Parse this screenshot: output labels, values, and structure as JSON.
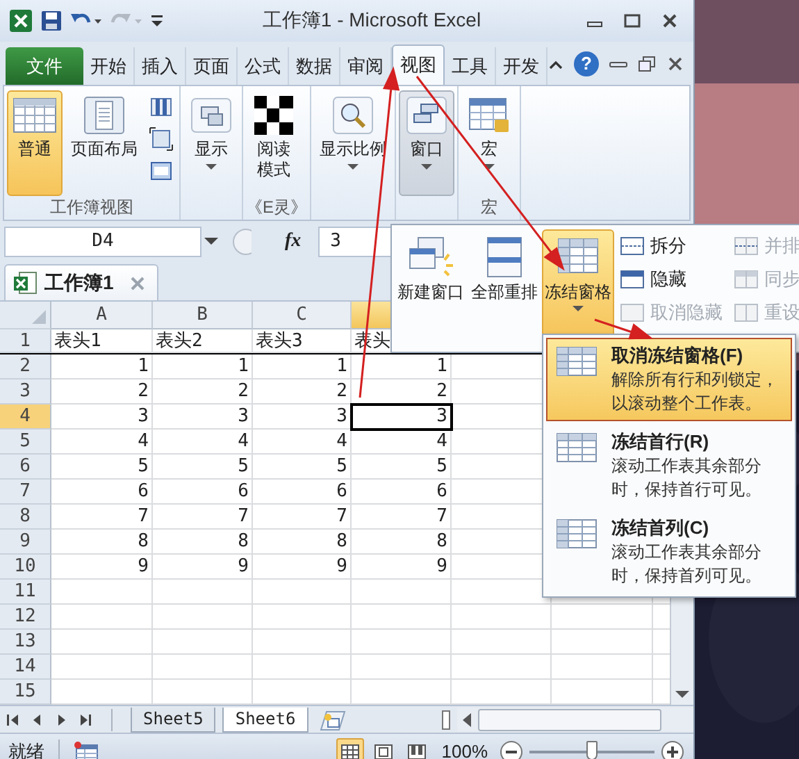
{
  "title_bar": {
    "title": "工作簿1 - Microsoft Excel",
    "quick_access": [
      {
        "kind": "save",
        "disabled": false
      },
      {
        "kind": "undo",
        "disabled": false
      },
      {
        "kind": "redo",
        "disabled": true
      }
    ]
  },
  "ribbon_tabs": [
    {
      "label": "文件",
      "kind": "file",
      "selected": false
    },
    {
      "label": "开始",
      "kind": "tab",
      "selected": false
    },
    {
      "label": "插入",
      "kind": "tab",
      "selected": false
    },
    {
      "label": "页面",
      "kind": "tab",
      "selected": false
    },
    {
      "label": "公式",
      "kind": "tab",
      "selected": false
    },
    {
      "label": "数据",
      "kind": "tab",
      "selected": false
    },
    {
      "label": "审阅",
      "kind": "tab",
      "selected": false
    },
    {
      "label": "视图",
      "kind": "tab",
      "selected": true
    },
    {
      "label": "工具",
      "kind": "tab",
      "selected": false
    },
    {
      "label": "开发",
      "kind": "tab",
      "selected": false
    }
  ],
  "help": "?",
  "ribbon_groups": [
    {
      "label": "工作簿视图",
      "buttons": [
        {
          "kind": "large",
          "label": "普通",
          "selected": true,
          "dropdown": false,
          "expanded": false
        },
        {
          "kind": "large",
          "label": "页面布局",
          "selected": false,
          "dropdown": false,
          "expanded": false
        },
        {
          "kind": "stack"
        }
      ]
    },
    {
      "buttons": [
        {
          "kind": "large",
          "label": "显示",
          "selected": false,
          "dropdown": true,
          "expanded": false
        }
      ]
    },
    {
      "label": "《E灵》",
      "buttons": [
        {
          "kind": "large",
          "label": "阅读模式",
          "selected": false,
          "dropdown": false,
          "expanded": false
        }
      ]
    },
    {
      "buttons": [
        {
          "kind": "large",
          "label": "显示比例",
          "selected": false,
          "dropdown": true,
          "expanded": false
        }
      ]
    },
    {
      "buttons": [
        {
          "kind": "large",
          "label": "窗口",
          "selected": false,
          "dropdown": true,
          "expanded": true
        }
      ]
    },
    {
      "label": "宏",
      "buttons": [
        {
          "kind": "large",
          "label": "宏",
          "selected": false,
          "dropdown": true,
          "expanded": false
        }
      ]
    }
  ],
  "formula_bar": {
    "name_box": "D4",
    "fx": "fx",
    "value": "3"
  },
  "workbook_tab": {
    "title": "工作簿1"
  },
  "sheet": {
    "columns": [
      {
        "label": "A",
        "selected": false
      },
      {
        "label": "B",
        "selected": false
      },
      {
        "label": "C",
        "selected": false
      },
      {
        "selected": true
      }
    ],
    "rows": [
      {
        "header": "1",
        "kind": "header",
        "selected": false,
        "cells": [
          "表头1",
          "表头2",
          "表头3",
          "表头"
        ]
      },
      {
        "header": "2",
        "kind": "data",
        "selected": false,
        "cells": [
          "1",
          "1",
          "1",
          "1"
        ]
      },
      {
        "header": "3",
        "kind": "data",
        "selected": false,
        "cells": [
          "2",
          "2",
          "2",
          "2"
        ]
      },
      {
        "header": "4",
        "kind": "data",
        "selected": true,
        "cells": [
          "3",
          "3",
          "3",
          "3"
        ]
      },
      {
        "header": "5",
        "kind": "data",
        "selected": false,
        "cells": [
          "4",
          "4",
          "4",
          "4"
        ]
      },
      {
        "header": "6",
        "kind": "data",
        "selected": false,
        "cells": [
          "5",
          "5",
          "5",
          "5"
        ]
      },
      {
        "header": "7",
        "kind": "data",
        "selected": false,
        "cells": [
          "6",
          "6",
          "6",
          "6"
        ]
      },
      {
        "header": "8",
        "kind": "data",
        "selected": false,
        "cells": [
          "7",
          "7",
          "7",
          "7"
        ]
      },
      {
        "header": "9",
        "kind": "data",
        "selected": false,
        "cells": [
          "8",
          "8",
          "8",
          "8"
        ]
      },
      {
        "header": "10",
        "kind": "data",
        "selected": false,
        "cells": [
          "9",
          "9",
          "9",
          "9"
        ]
      },
      {
        "header": "11",
        "kind": "data",
        "selected": false,
        "cells": []
      },
      {
        "header": "12",
        "kind": "data",
        "selected": false,
        "cells": []
      },
      {
        "header": "13",
        "kind": "data",
        "selected": false,
        "cells": []
      },
      {
        "header": "14",
        "kind": "data",
        "selected": false,
        "cells": []
      },
      {
        "header": "15",
        "kind": "data",
        "selected": false,
        "cells": []
      }
    ]
  },
  "sheet_tabs": [
    {
      "label": "Sheet5",
      "selected": false
    },
    {
      "label": "Sheet6",
      "selected": true
    }
  ],
  "status_bar": {
    "status": "就绪",
    "views": [
      {
        "kind": "normal",
        "selected": true
      },
      {
        "kind": "layout",
        "selected": false
      },
      {
        "kind": "break",
        "selected": false
      }
    ],
    "zoom": "100%",
    "zoom_slider": {
      "level": 0.5
    }
  },
  "window_panel": {
    "large": [
      {
        "label": "新建窗口",
        "selected": false,
        "dropdown": false
      },
      {
        "label": "全部重排",
        "selected": false,
        "dropdown": false
      },
      {
        "label": "冻结窗格",
        "selected": true,
        "dropdown": true
      }
    ],
    "small": [
      {
        "label": "拆分",
        "disabled": false
      },
      {
        "label": "隐藏",
        "disabled": false
      },
      {
        "label": "取消隐藏",
        "disabled": true
      },
      {
        "label": "并排",
        "disabled": true
      },
      {
        "label": "同步",
        "disabled": true
      },
      {
        "label": "重设",
        "disabled": true
      }
    ]
  },
  "freeze_menu": [
    {
      "title": "取消冻结窗格(F)",
      "description": "解除所有行和列锁定，以滚动整个工作表。",
      "selected": true
    },
    {
      "title": "冻结首行(R)",
      "description": "滚动工作表其余部分时，保持首行可见。",
      "selected": false
    },
    {
      "title": "冻结首列(C)",
      "description": "滚动工作表其余部分时，保持首列可见。",
      "selected": false
    }
  ]
}
